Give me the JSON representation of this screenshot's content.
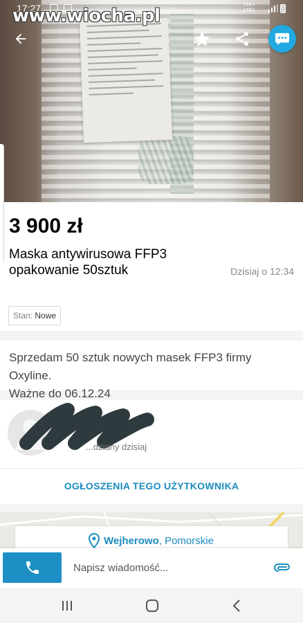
{
  "status_bar": {
    "time": "17:27",
    "network": "LTE+",
    "network2": "LTE1"
  },
  "watermark": "www.wiocha.pl",
  "top_bar": {
    "back_icon": "arrow-left-icon",
    "favorite_icon": "star-icon",
    "share_icon": "share-icon",
    "chat_icon": "chat-bubble-icon",
    "accent": "#23a9e1"
  },
  "listing": {
    "price": "3 900 zł",
    "title_line1": "Maska antywirusowa FFP3",
    "title_line2": "opakowanie 50sztuk",
    "posted": "Dzisiaj o 12:34",
    "condition_label": "Stan:",
    "condition_value": "Nowe",
    "description_line1": "Sprzedam 50 sztuk nowych masek FFP3 firmy Oxyline.",
    "description_line2": "Ważne do 06.12.24"
  },
  "seller": {
    "last_seen": "...dziany dzisiaj",
    "ads_link": "OGŁOSZENIA TEGO UŻYTKOWNIKA",
    "link_color": "#1b8cbd"
  },
  "location": {
    "city": "Wejherowo",
    "region": ", Pomorskie"
  },
  "message_bar": {
    "placeholder": "Napisz wiadomość...",
    "call_icon": "phone-icon",
    "attach_icon": "paperclip-icon"
  },
  "nav": {
    "recent_icon": "recent-apps-icon",
    "home_icon": "home-icon",
    "back_icon": "back-chevron-icon"
  }
}
